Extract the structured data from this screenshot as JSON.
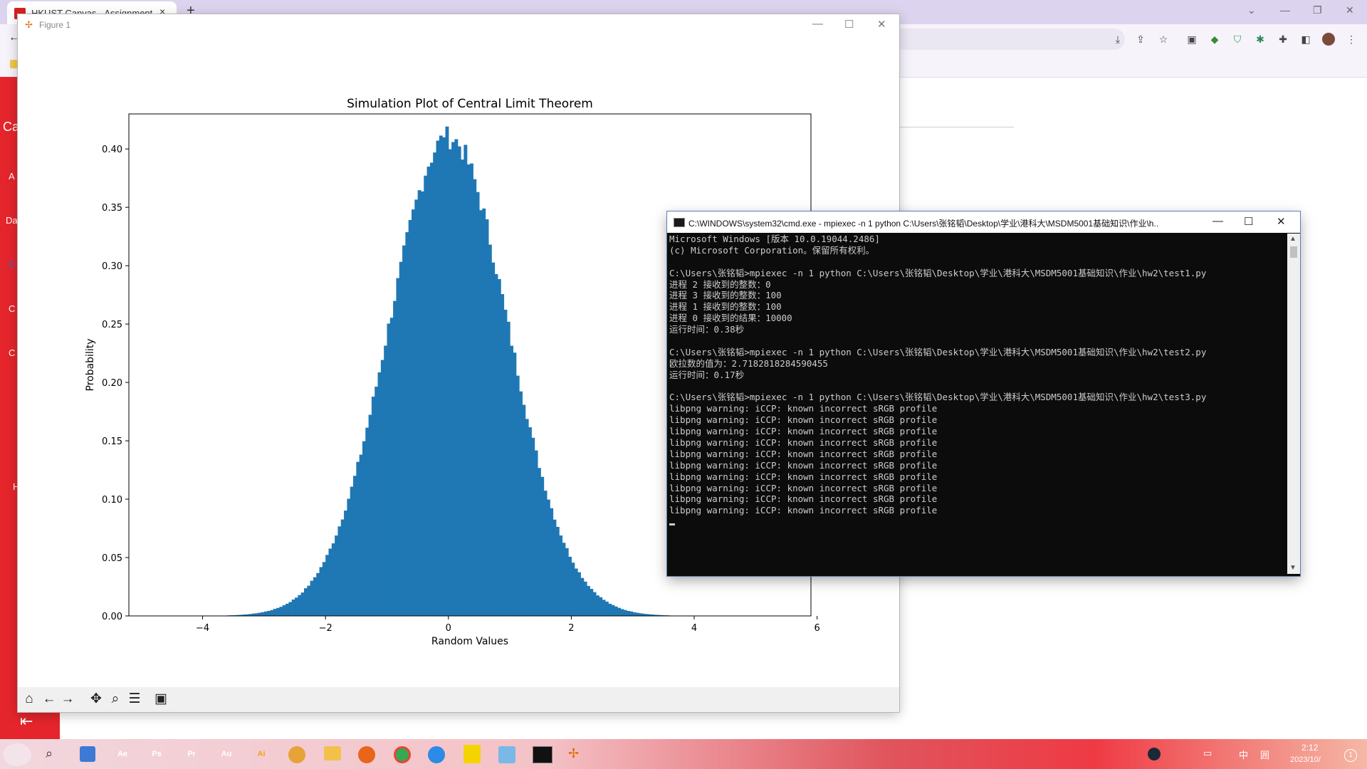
{
  "browser": {
    "tab_title": "HKUST Canvas - Assignment",
    "tab_close": "×",
    "new_tab": "+",
    "sidebar_labels": [
      "Ca",
      "A",
      "Da",
      "C",
      "C",
      "C",
      "H"
    ]
  },
  "taskbar": {
    "apps": [
      {
        "name": "Ae",
        "color": "#1a0a4a"
      },
      {
        "name": "Ps",
        "color": "#0b2a4d"
      },
      {
        "name": "Pr",
        "color": "#170b4a"
      },
      {
        "name": "Au",
        "color": "#0b2a4a"
      },
      {
        "name": "Ai",
        "color": "#3a1a00"
      }
    ],
    "clock_time": "2:12",
    "clock_date": "2023/10/"
  },
  "figure": {
    "window_title": "Figure 1",
    "toolbar": [
      "home-icon",
      "back-icon",
      "forward-icon",
      "pan-icon",
      "zoom-icon",
      "configure-icon",
      "save-icon"
    ]
  },
  "cmd": {
    "window_title": "C:\\WINDOWS\\system32\\cmd.exe - mpiexec  -n 1 python C:\\Users\\张铭韬\\Desktop\\学业\\港科大\\MSDM5001基础知识\\作业\\h...",
    "lines": [
      "Microsoft Windows [版本 10.0.19044.2486]",
      "(c) Microsoft Corporation。保留所有权利。",
      "",
      "C:\\Users\\张铭韬>mpiexec -n 1 python C:\\Users\\张铭韬\\Desktop\\学业\\港科大\\MSDM5001基础知识\\作业\\hw2\\test1.py",
      "进程 2 接收到的整数：0",
      "进程 3 接收到的整数：100",
      "进程 1 接收到的整数：100",
      "进程 0 接收到的结果：10000",
      "运行时间：0.38秒",
      "",
      "C:\\Users\\张铭韬>mpiexec -n 1 python C:\\Users\\张铭韬\\Desktop\\学业\\港科大\\MSDM5001基础知识\\作业\\hw2\\test2.py",
      "欧拉数的值为：2.7182818284590455",
      "运行时间：0.17秒",
      "",
      "C:\\Users\\张铭韬>mpiexec -n 1 python C:\\Users\\张铭韬\\Desktop\\学业\\港科大\\MSDM5001基础知识\\作业\\hw2\\test3.py",
      "libpng warning: iCCP: known incorrect sRGB profile",
      "libpng warning: iCCP: known incorrect sRGB profile",
      "libpng warning: iCCP: known incorrect sRGB profile",
      "libpng warning: iCCP: known incorrect sRGB profile",
      "libpng warning: iCCP: known incorrect sRGB profile",
      "libpng warning: iCCP: known incorrect sRGB profile",
      "libpng warning: iCCP: known incorrect sRGB profile",
      "libpng warning: iCCP: known incorrect sRGB profile",
      "libpng warning: iCCP: known incorrect sRGB profile",
      "libpng warning: iCCP: known incorrect sRGB profile"
    ]
  },
  "chart_data": {
    "type": "bar",
    "title": "Simulation Plot of Central Limit Theorem",
    "xlabel": "Random Values",
    "ylabel": "Probability",
    "xlim": [
      -5.2,
      5.9
    ],
    "ylim": [
      0,
      0.43
    ],
    "xticks": [
      -4,
      -2,
      0,
      2,
      4,
      6
    ],
    "yticks": [
      0.0,
      0.05,
      0.1,
      0.15,
      0.2,
      0.25,
      0.3,
      0.35,
      0.4
    ],
    "bar_color": "#1f77b4",
    "bin_width": 0.05,
    "bin_start": -4.5,
    "distribution": {
      "mean": 0.0,
      "std": 0.97,
      "peak": 0.41
    },
    "peak_x": -0.1,
    "grid": false
  }
}
